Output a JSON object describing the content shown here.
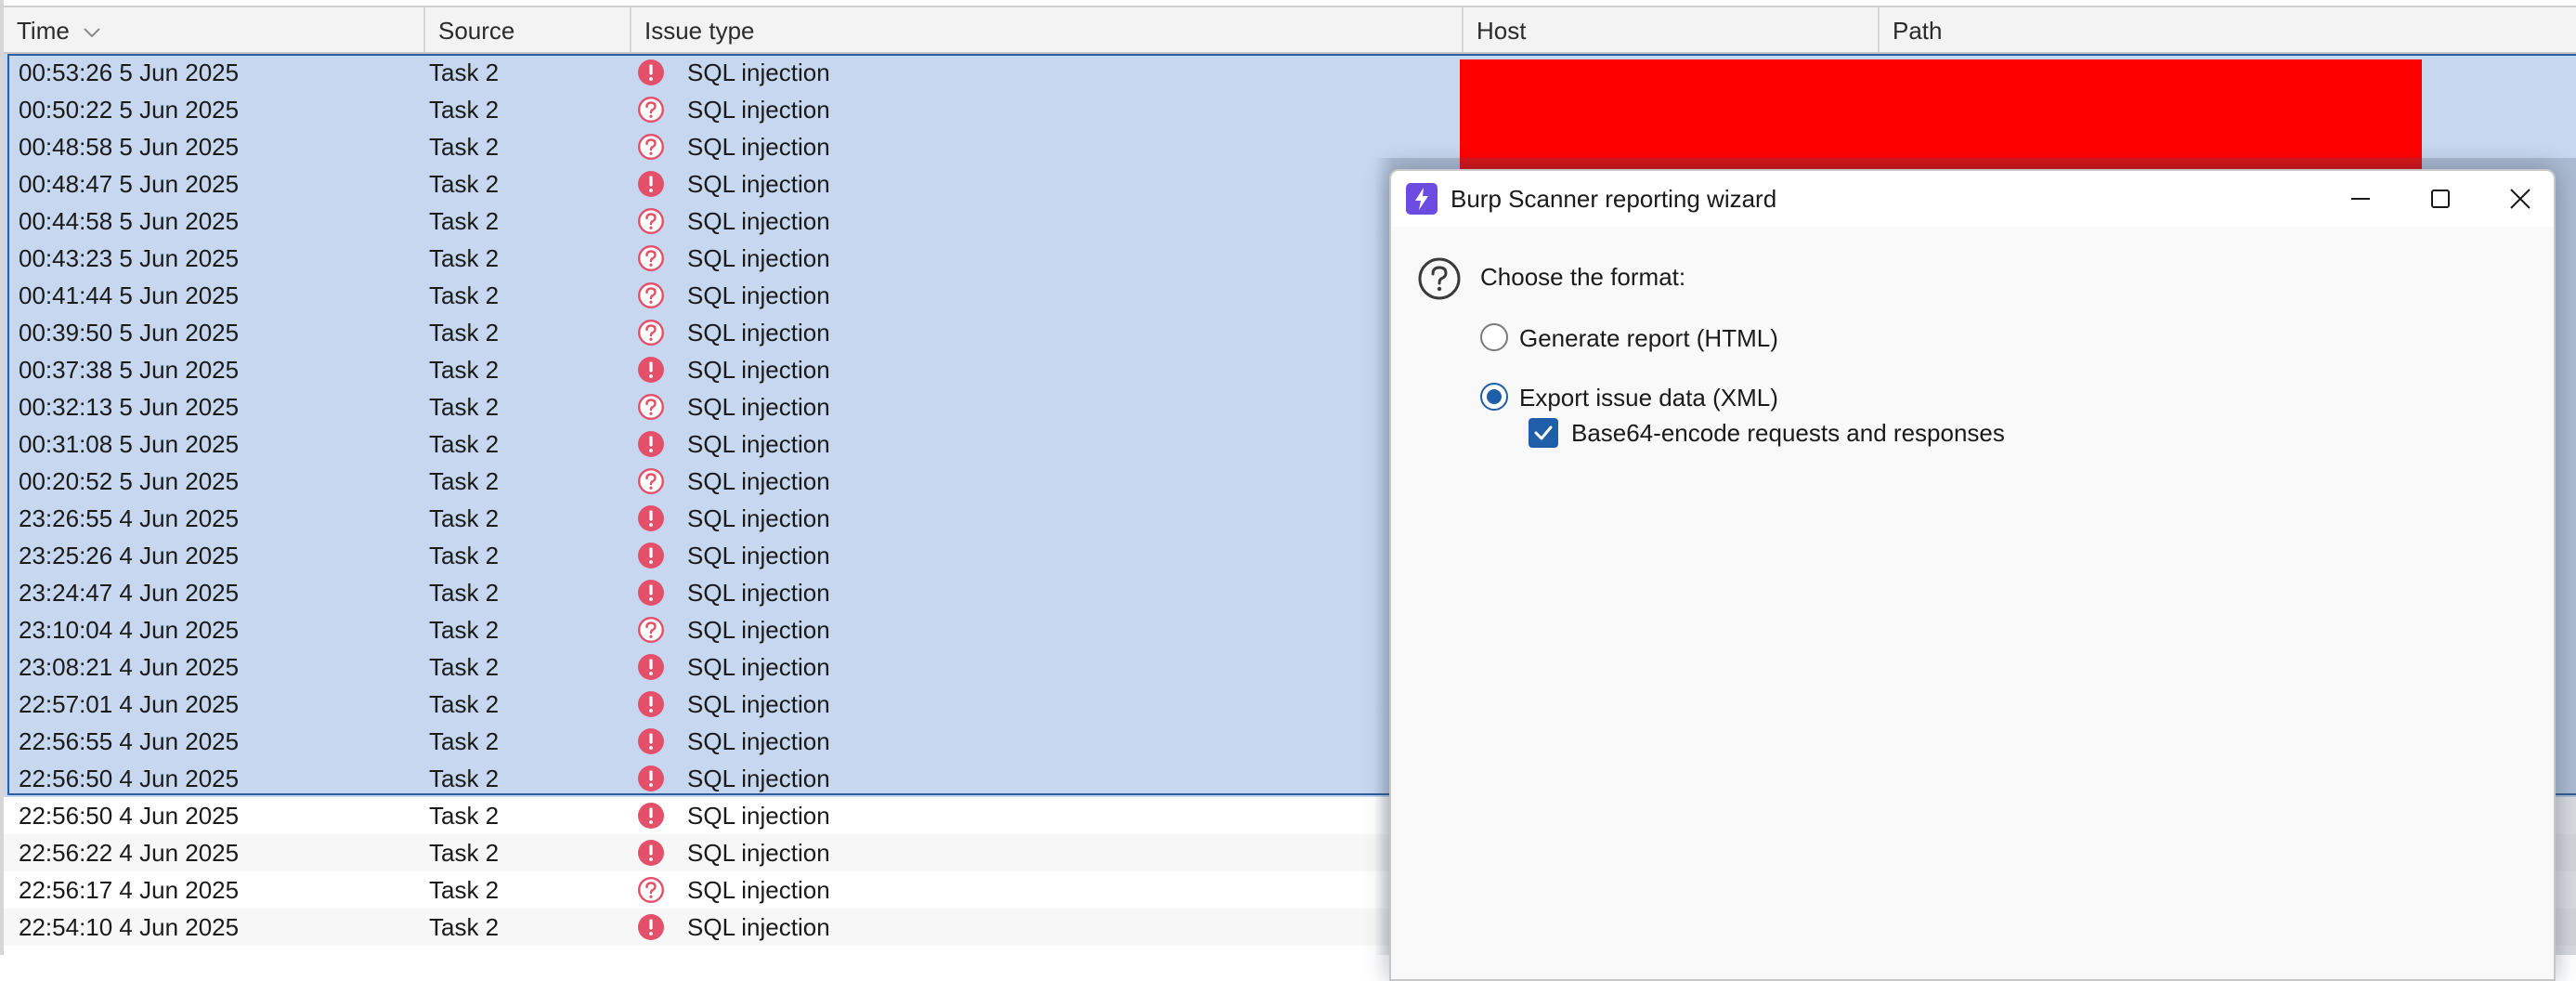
{
  "table": {
    "columns": {
      "time": "Time",
      "source": "Source",
      "issue_type": "Issue type",
      "host": "Host",
      "path": "Path"
    },
    "rows": [
      {
        "time": "00:53:26 5 Jun 2025",
        "source": "Task 2",
        "severity": "certain",
        "issue": "SQL injection",
        "selected": true
      },
      {
        "time": "00:50:22 5 Jun 2025",
        "source": "Task 2",
        "severity": "tentative",
        "issue": "SQL injection",
        "selected": true
      },
      {
        "time": "00:48:58 5 Jun 2025",
        "source": "Task 2",
        "severity": "tentative",
        "issue": "SQL injection",
        "selected": true
      },
      {
        "time": "00:48:47 5 Jun 2025",
        "source": "Task 2",
        "severity": "certain",
        "issue": "SQL injection",
        "selected": true
      },
      {
        "time": "00:44:58 5 Jun 2025",
        "source": "Task 2",
        "severity": "tentative",
        "issue": "SQL injection",
        "selected": true
      },
      {
        "time": "00:43:23 5 Jun 2025",
        "source": "Task 2",
        "severity": "tentative",
        "issue": "SQL injection",
        "selected": true
      },
      {
        "time": "00:41:44 5 Jun 2025",
        "source": "Task 2",
        "severity": "tentative",
        "issue": "SQL injection",
        "selected": true
      },
      {
        "time": "00:39:50 5 Jun 2025",
        "source": "Task 2",
        "severity": "tentative",
        "issue": "SQL injection",
        "selected": true
      },
      {
        "time": "00:37:38 5 Jun 2025",
        "source": "Task 2",
        "severity": "certain",
        "issue": "SQL injection",
        "selected": true
      },
      {
        "time": "00:32:13 5 Jun 2025",
        "source": "Task 2",
        "severity": "tentative",
        "issue": "SQL injection",
        "selected": true
      },
      {
        "time": "00:31:08 5 Jun 2025",
        "source": "Task 2",
        "severity": "certain",
        "issue": "SQL injection",
        "selected": true
      },
      {
        "time": "00:20:52 5 Jun 2025",
        "source": "Task 2",
        "severity": "tentative",
        "issue": "SQL injection",
        "selected": true
      },
      {
        "time": "23:26:55 4 Jun 2025",
        "source": "Task 2",
        "severity": "certain",
        "issue": "SQL injection",
        "selected": true
      },
      {
        "time": "23:25:26 4 Jun 2025",
        "source": "Task 2",
        "severity": "certain",
        "issue": "SQL injection",
        "selected": true
      },
      {
        "time": "23:24:47 4 Jun 2025",
        "source": "Task 2",
        "severity": "certain",
        "issue": "SQL injection",
        "selected": true
      },
      {
        "time": "23:10:04 4 Jun 2025",
        "source": "Task 2",
        "severity": "tentative",
        "issue": "SQL injection",
        "selected": true
      },
      {
        "time": "23:08:21 4 Jun 2025",
        "source": "Task 2",
        "severity": "certain",
        "issue": "SQL injection",
        "selected": true
      },
      {
        "time": "22:57:01 4 Jun 2025",
        "source": "Task 2",
        "severity": "certain",
        "issue": "SQL injection",
        "selected": true
      },
      {
        "time": "22:56:55 4 Jun 2025",
        "source": "Task 2",
        "severity": "certain",
        "issue": "SQL injection",
        "selected": true
      },
      {
        "time": "22:56:50 4 Jun 2025",
        "source": "Task 2",
        "severity": "certain",
        "issue": "SQL injection",
        "selected": true
      },
      {
        "time": "22:56:50 4 Jun 2025",
        "source": "Task 2",
        "severity": "certain",
        "issue": "SQL injection",
        "selected": false
      },
      {
        "time": "22:56:22 4 Jun 2025",
        "source": "Task 2",
        "severity": "certain",
        "issue": "SQL injection",
        "selected": false
      },
      {
        "time": "22:56:17 4 Jun 2025",
        "source": "Task 2",
        "severity": "tentative",
        "issue": "SQL injection",
        "selected": false
      },
      {
        "time": "22:54:10 4 Jun 2025",
        "source": "Task 2",
        "severity": "certain",
        "issue": "SQL injection",
        "selected": false
      }
    ]
  },
  "dialog": {
    "title": "Burp Scanner reporting wizard",
    "prompt": "Choose the format:",
    "options": [
      {
        "label": "Generate report (HTML)",
        "selected": false
      },
      {
        "label": "Export issue data (XML)",
        "selected": true
      }
    ],
    "checkbox": {
      "label": "Base64-encode requests and responses",
      "checked": true
    }
  },
  "colors": {
    "selection": "#c6d7ef",
    "selection_border": "#2c5d9d",
    "severity_red": "#e4506a",
    "redaction": "#ff0000",
    "accent_blue": "#1f5ea8",
    "app_icon": "#6c4ce0"
  },
  "icons": {
    "sort": "chevron-down-icon",
    "certain": "exclamation-circle-icon",
    "tentative": "question-circle-icon",
    "help": "help-circle-icon",
    "app": "burp-lightning-icon"
  }
}
